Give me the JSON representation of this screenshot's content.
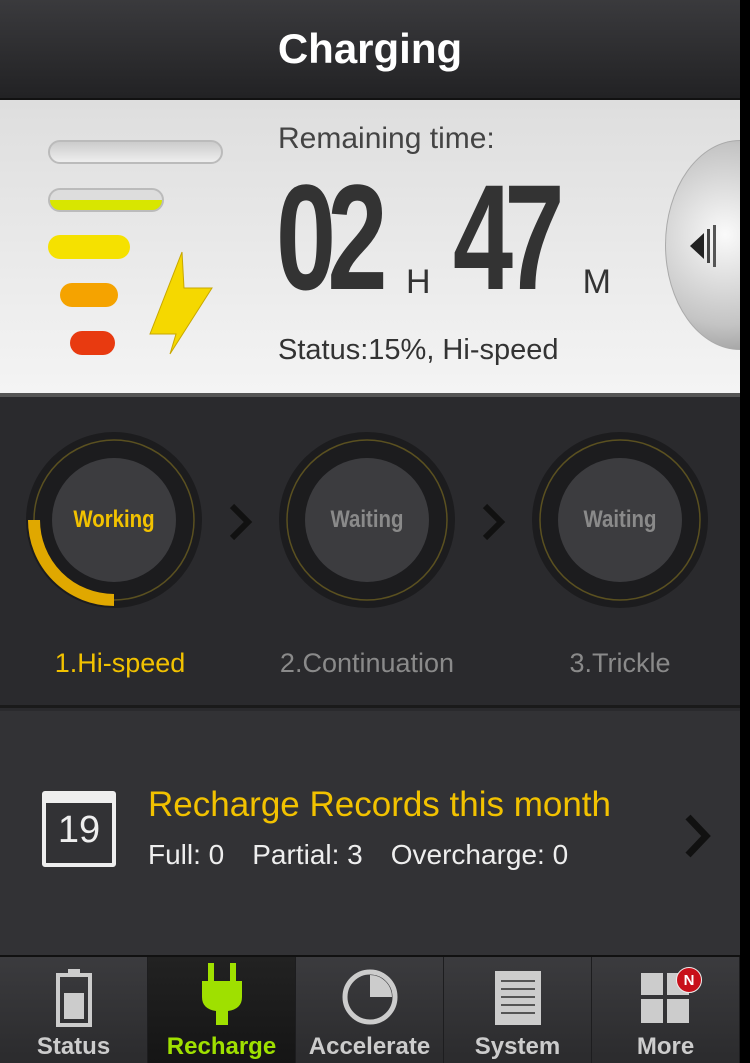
{
  "header": {
    "title": "Charging"
  },
  "charge": {
    "remaining_label": "Remaining time:",
    "hours": "02",
    "hours_unit": "H",
    "minutes": "47",
    "minutes_unit": "M",
    "status": "Status:15%, Hi-speed",
    "percent": 15
  },
  "stages": [
    {
      "state": "Working",
      "label": "1.Hi-speed",
      "active": true
    },
    {
      "state": "Waiting",
      "label": "2.Continuation",
      "active": false
    },
    {
      "state": "Waiting",
      "label": "3.Trickle",
      "active": false
    }
  ],
  "records": {
    "calendar_day": "19",
    "title": "Recharge Records this month",
    "full": "Full: 0",
    "partial": "Partial: 3",
    "overcharge": "Overcharge: 0"
  },
  "tabs": [
    {
      "label": "Status",
      "icon": "battery-icon"
    },
    {
      "label": "Recharge",
      "icon": "plug-icon",
      "active": true
    },
    {
      "label": "Accelerate",
      "icon": "pie-icon"
    },
    {
      "label": "System",
      "icon": "notepad-icon"
    },
    {
      "label": "More",
      "icon": "grid-icon",
      "badge": "N"
    }
  ],
  "colors": {
    "accent": "#f2c200",
    "active_tab": "#9fe000"
  }
}
